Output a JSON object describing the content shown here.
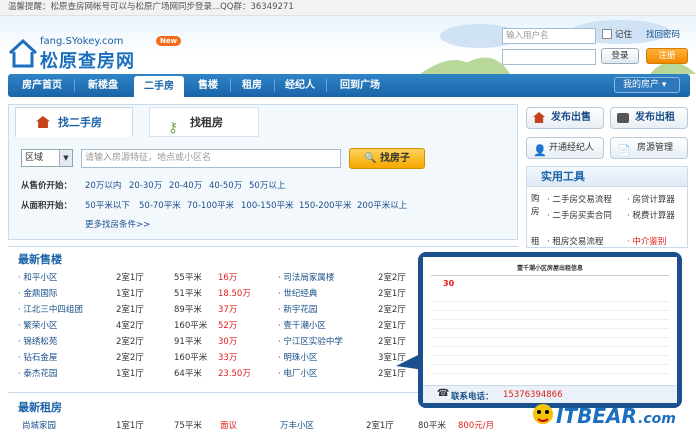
{
  "topbar": {
    "notice": "温馨提醒：松原查房网帐号可以与松原广场网同步登录...QQ群：36349271"
  },
  "logo": {
    "url": "fang.SYokey.com",
    "name": "松原查房网",
    "badge": "New"
  },
  "login": {
    "username_placeholder": "输入用户名",
    "remember": "记住",
    "forgot": "找回密码",
    "login_btn": "登录",
    "register_btn": "注册"
  },
  "nav": {
    "items": [
      "房产首页",
      "新楼盘",
      "二手房",
      "售楼",
      "租房",
      "经纪人",
      "回到广场"
    ],
    "my": "我的房产"
  },
  "search": {
    "tab1": "找二手房",
    "tab2": "找租房",
    "region": "区域",
    "placeholder": "请输入房源特征，地点或小区名",
    "button": "找房子",
    "price_label": "从售价开始：",
    "prices": [
      "20万以内",
      "20-30万",
      "20-40万",
      "40-50万",
      "50万以上"
    ],
    "area_label": "从面积开始：",
    "areas": [
      "50平米以下",
      "50-70平米",
      "70-100平米",
      "100-150平米",
      "150-200平米",
      "200平米以上"
    ],
    "more": "更多找房条件>>"
  },
  "right": {
    "sell": "发布出售",
    "rent": "发布出租",
    "agent": "开通经纪人",
    "manage": "房源管理",
    "tools_title": "实用工具",
    "buy": "购房",
    "rentcat": "租",
    "tools": [
      "二手房交易流程",
      "房贷计算器",
      "二手房买卖合同",
      "税费计算器",
      "租房交易流程",
      "中介鉴别"
    ]
  },
  "sale": {
    "title": "最新售楼",
    "rows": [
      [
        "和平小区",
        "2室1厅",
        "55平米",
        "16万"
      ],
      [
        "金鼎国际",
        "1室1厅",
        "51平米",
        "18.50万"
      ],
      [
        "江北三中四组团",
        "2室1厅",
        "89平米",
        "37万"
      ],
      [
        "繁荣小区",
        "4室2厅",
        "160平米",
        "52万"
      ],
      [
        "锦绣松苑",
        "2室2厅",
        "91平米",
        "30万"
      ],
      [
        "钻石金屋",
        "2室2厅",
        "160平米",
        "33万"
      ],
      [
        "泰杰花园",
        "1室1厅",
        "64平米",
        "23.50万"
      ]
    ],
    "rows2": [
      [
        "司法局家属楼",
        "2室2厅"
      ],
      [
        "世纪经典",
        "2室1厅"
      ],
      [
        "新宇花园",
        "2室2厅"
      ],
      [
        "壹千潮小区",
        "2室1厅"
      ],
      [
        "宁江区实验中学",
        "2室1厅"
      ],
      [
        "明珠小区",
        "3室1厅"
      ],
      [
        "电厂小区",
        "2室1厅"
      ]
    ]
  },
  "rent": {
    "title": "最新租房",
    "row": [
      "尚城家园",
      "1室1厅",
      "75平米",
      "面议"
    ],
    "row2": [
      "万丰小区",
      "2室1厅",
      "80平米",
      "800元/月"
    ]
  },
  "popup": {
    "title": "壹千潮小区房屋出租信息",
    "price": "30",
    "phone_label": "联系电话：",
    "phone": "15376394866"
  },
  "watermark": "ITBEAR",
  "watermark_domain": ".com"
}
